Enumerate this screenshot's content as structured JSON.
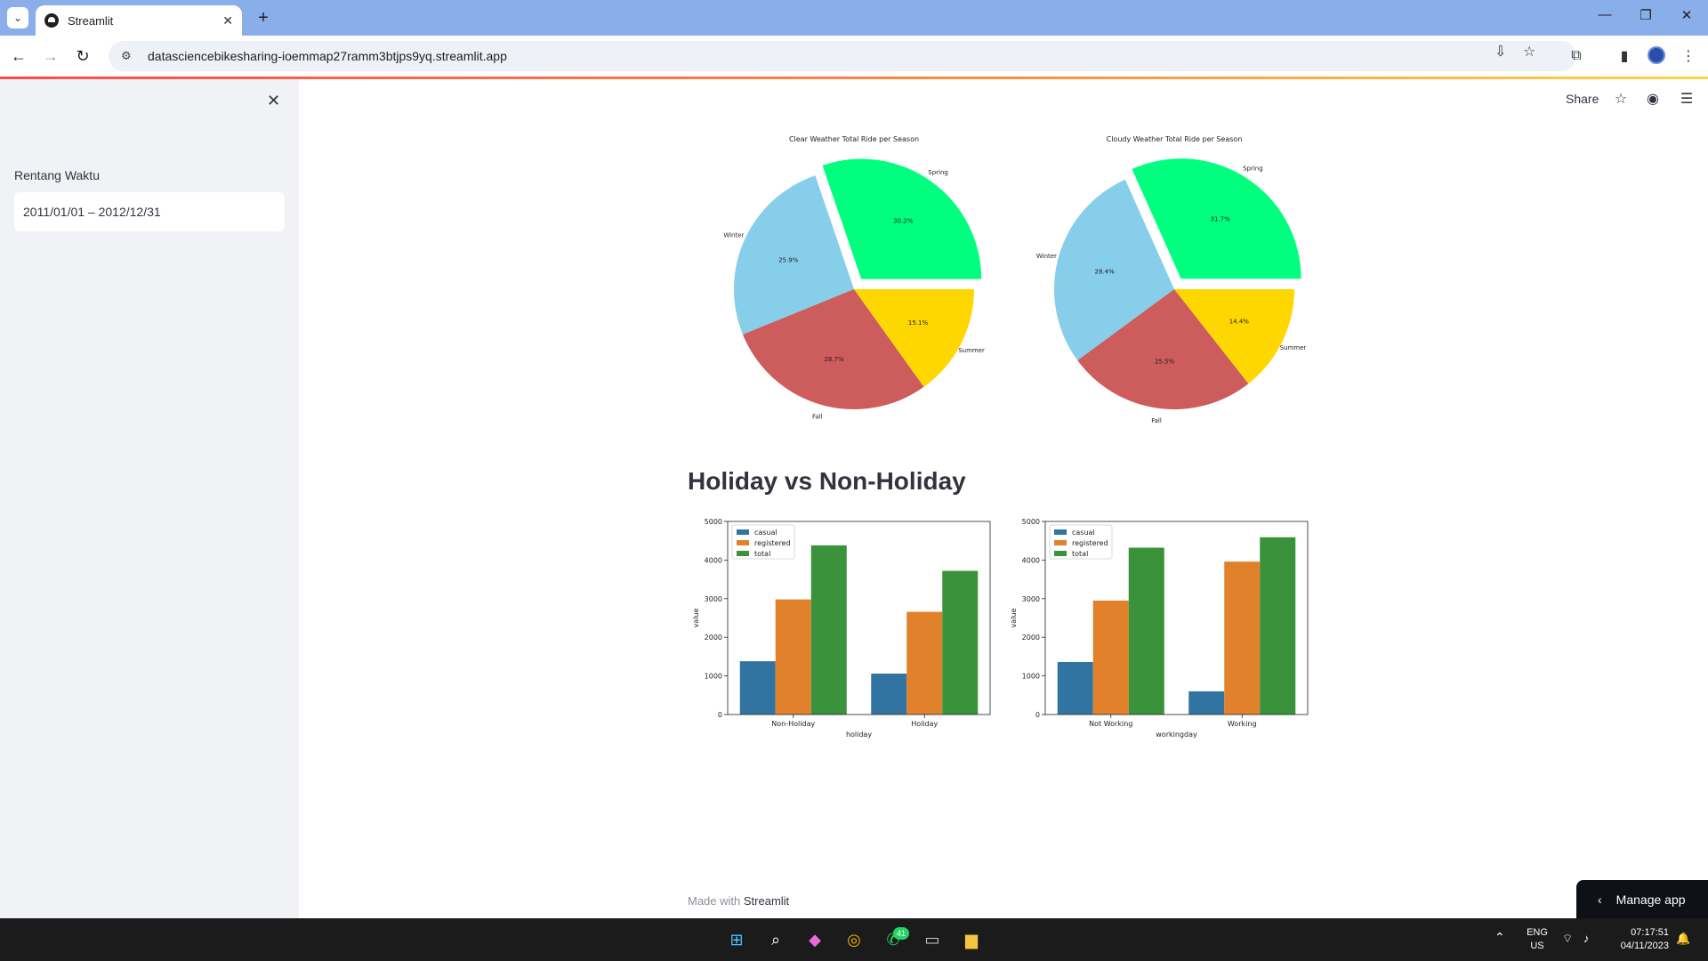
{
  "browser": {
    "tab_title": "Streamlit",
    "url": "datasciencebikesharing-ioemmap27ramm3btjps9yq.streamlit.app"
  },
  "sidebar": {
    "filter_label": "Rentang Waktu",
    "date_range_value": "2011/01/01 – 2012/12/31"
  },
  "header": {
    "share_label": "Share"
  },
  "section_heading": "Holiday vs Non-Holiday",
  "footer": {
    "made_with": "Made with",
    "brand": "Streamlit"
  },
  "manage_app_label": "Manage app",
  "taskbar": {
    "lang": "ENG",
    "region": "US",
    "time": "07:17:51",
    "date": "04/11/2023",
    "whatsapp_badge": "41"
  },
  "colors": {
    "Spring": "#00ff7f",
    "Summer": "#ffd700",
    "Fall": "#cd5c5c",
    "Winter": "#87ceeb",
    "casual": "#3274a1",
    "registered": "#e1812c",
    "total": "#3a923a"
  },
  "chart_data": [
    {
      "type": "pie",
      "title": "Clear Weather Total Ride per Season",
      "slices": [
        {
          "label": "Spring",
          "value": 30.2,
          "pct_label": "30.2%"
        },
        {
          "label": "Winter",
          "value": 25.9,
          "pct_label": "25.9%"
        },
        {
          "label": "Fall",
          "value": 28.7,
          "pct_label": "28.7%"
        },
        {
          "label": "Summer",
          "value": 15.1,
          "pct_label": "15.1%"
        }
      ],
      "explode": "Spring"
    },
    {
      "type": "pie",
      "title": "Cloudy Weather Total Ride per Season",
      "slices": [
        {
          "label": "Spring",
          "value": 31.7,
          "pct_label": "31.7%"
        },
        {
          "label": "Winter",
          "value": 28.4,
          "pct_label": "28.4%"
        },
        {
          "label": "Fall",
          "value": 25.5,
          "pct_label": "25.5%"
        },
        {
          "label": "Summer",
          "value": 14.4,
          "pct_label": "14.4%"
        }
      ],
      "explode": "Spring"
    },
    {
      "type": "bar",
      "title": "",
      "categories": [
        "Non-Holiday",
        "Holiday"
      ],
      "series": [
        {
          "name": "casual",
          "values": [
            1380,
            1060
          ]
        },
        {
          "name": "registered",
          "values": [
            2980,
            2660
          ]
        },
        {
          "name": "total",
          "values": [
            4380,
            3720
          ]
        }
      ],
      "xlabel": "holiday",
      "ylabel": "value",
      "ylim": [
        0,
        5000
      ],
      "yticks": [
        0,
        1000,
        2000,
        3000,
        4000,
        5000
      ],
      "legend": "upper-left"
    },
    {
      "type": "bar",
      "title": "",
      "categories": [
        "Not Working",
        "Working"
      ],
      "series": [
        {
          "name": "casual",
          "values": [
            1360,
            600
          ]
        },
        {
          "name": "registered",
          "values": [
            2950,
            3960
          ]
        },
        {
          "name": "total",
          "values": [
            4320,
            4590
          ]
        }
      ],
      "xlabel": "workingday",
      "ylabel": "value",
      "ylim": [
        0,
        5000
      ],
      "yticks": [
        0,
        1000,
        2000,
        3000,
        4000,
        5000
      ],
      "legend": "upper-left"
    }
  ]
}
